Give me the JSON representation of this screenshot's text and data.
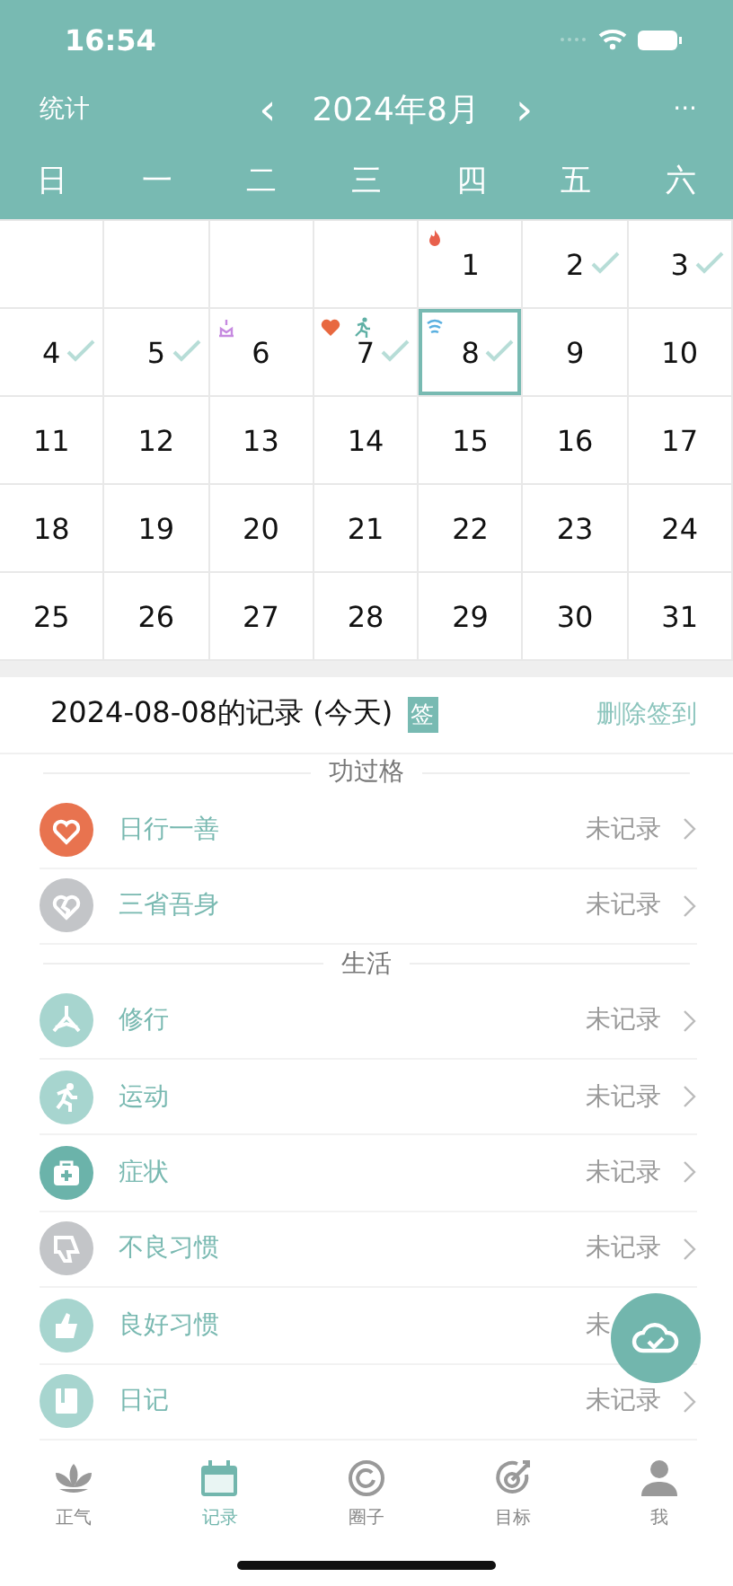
{
  "status_bar": {
    "time": "16:54"
  },
  "header": {
    "left": "统计",
    "prev": "‹",
    "title": "2024年8月",
    "next": "›",
    "more": "···"
  },
  "weekdays": [
    "日",
    "一",
    "二",
    "三",
    "四",
    "五",
    "六"
  ],
  "calendar": {
    "days": [
      {
        "day": "1",
        "checked": false,
        "selected": false,
        "marks": [
          {
            "kind": "fire"
          }
        ]
      },
      {
        "day": "2",
        "checked": true,
        "selected": false
      },
      {
        "day": "3",
        "checked": true,
        "selected": false
      },
      {
        "day": "4",
        "checked": true,
        "selected": false
      },
      {
        "day": "5",
        "checked": true,
        "selected": false
      },
      {
        "day": "6",
        "checked": false,
        "selected": false,
        "marks": [
          {
            "kind": "meditation"
          }
        ]
      },
      {
        "day": "7",
        "checked": true,
        "selected": false,
        "marks": [
          {
            "kind": "heart"
          },
          {
            "kind": "runner"
          }
        ]
      },
      {
        "day": "8",
        "checked": true,
        "selected": true,
        "marks": [
          {
            "kind": "wave"
          }
        ]
      },
      {
        "day": "9",
        "checked": false,
        "selected": false
      },
      {
        "day": "10",
        "checked": false,
        "selected": false
      },
      {
        "day": "11",
        "checked": false,
        "selected": false
      },
      {
        "day": "12",
        "checked": false,
        "selected": false
      },
      {
        "day": "13",
        "checked": false,
        "selected": false
      },
      {
        "day": "14",
        "checked": false,
        "selected": false
      },
      {
        "day": "15",
        "checked": false,
        "selected": false
      },
      {
        "day": "16",
        "checked": false,
        "selected": false
      },
      {
        "day": "17",
        "checked": false,
        "selected": false
      },
      {
        "day": "18",
        "checked": false,
        "selected": false
      },
      {
        "day": "19",
        "checked": false,
        "selected": false
      },
      {
        "day": "20",
        "checked": false,
        "selected": false
      },
      {
        "day": "21",
        "checked": false,
        "selected": false
      },
      {
        "day": "22",
        "checked": false,
        "selected": false
      },
      {
        "day": "23",
        "checked": false,
        "selected": false
      },
      {
        "day": "24",
        "checked": false,
        "selected": false
      },
      {
        "day": "25",
        "checked": false,
        "selected": false
      },
      {
        "day": "26",
        "checked": false,
        "selected": false
      },
      {
        "day": "27",
        "checked": false,
        "selected": false
      },
      {
        "day": "28",
        "checked": false,
        "selected": false
      },
      {
        "day": "29",
        "checked": false,
        "selected": false
      },
      {
        "day": "30",
        "checked": false,
        "selected": false
      },
      {
        "day": "31",
        "checked": false,
        "selected": false
      }
    ]
  },
  "record": {
    "title": "2024-08-08的记录 (今天)",
    "badge": "签",
    "action": "删除签到"
  },
  "sections": [
    {
      "title": "功过格",
      "items": [
        {
          "kind": "heart",
          "color": "#e8734f",
          "label": "日行一善",
          "status": "未记录",
          "chevron": true
        },
        {
          "kind": "broken-heart",
          "color": "#c3c5c8",
          "label": "三省吾身",
          "status": "未记录",
          "chevron": true
        }
      ]
    },
    {
      "title": "生活",
      "items": [
        {
          "kind": "meditation",
          "color": "#a7d5cf",
          "label": "修行",
          "status": "未记录",
          "chevron": true
        },
        {
          "kind": "runner",
          "color": "#a7d5cf",
          "label": "运动",
          "status": "未记录",
          "chevron": true
        },
        {
          "kind": "medkit",
          "color": "#6bb3aa",
          "label": "症状",
          "status": "未记录",
          "chevron": true
        },
        {
          "kind": "thumb-down",
          "color": "#c3c5c8",
          "label": "不良习惯",
          "status": "未记录",
          "chevron": true
        },
        {
          "kind": "thumb-up",
          "color": "#a7d5cf",
          "label": "良好习惯",
          "status": "未",
          "chevron": false
        },
        {
          "kind": "book",
          "color": "#a7d5cf",
          "label": "日记",
          "status": "未记录",
          "chevron": true
        }
      ]
    }
  ],
  "tabs": [
    {
      "kind": "lotus",
      "label": "正气",
      "selected": false
    },
    {
      "kind": "calendar",
      "label": "记录",
      "selected": true
    },
    {
      "kind": "circle",
      "label": "圈子",
      "selected": false
    },
    {
      "kind": "target",
      "label": "目标",
      "selected": false
    },
    {
      "kind": "person",
      "label": "我",
      "selected": false
    }
  ]
}
